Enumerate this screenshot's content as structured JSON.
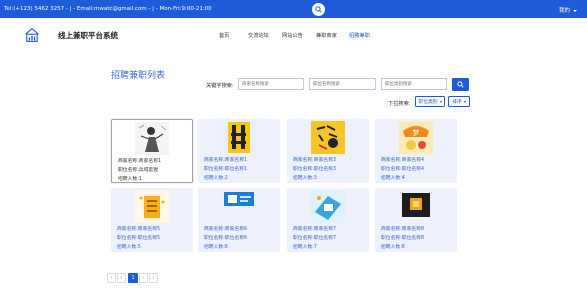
{
  "topbar": {
    "info": "Tel:(+123) 5462 3257 - | - Email:mwatc@gmail.com - | - Mon-Fri:9:00-21:00",
    "user_label": "我的"
  },
  "header": {
    "site_title": "线上兼职平台系统",
    "nav": [
      {
        "label": "首页",
        "active": false
      },
      {
        "label": "交流论坛",
        "active": false
      },
      {
        "label": "网站公告",
        "active": false
      },
      {
        "label": "兼职商家",
        "active": false
      },
      {
        "label": "招聘兼职",
        "active": true
      }
    ]
  },
  "main": {
    "title": "招聘兼职列表",
    "search": {
      "label": "关键字搜索:",
      "fields": [
        {
          "placeholder": "商家名称搜索"
        },
        {
          "placeholder": "职位名称搜索"
        },
        {
          "placeholder": "职位类别搜索"
        }
      ]
    },
    "sort": {
      "label": "下拉搜索:",
      "options": [
        "职位类别",
        "排序"
      ]
    },
    "cards": [
      {
        "merchant": "商家名称:商家名称1",
        "position": "职位名称:兵域逛猩",
        "count": "招聘人数:1",
        "selected": true
      },
      {
        "merchant": "商家名称:商家名称1",
        "position": "职位名称:职位名称1",
        "count": "招聘人数:2",
        "selected": false
      },
      {
        "merchant": "商家名称:商家名称3",
        "position": "职位名称:职位名称3",
        "count": "招聘人数:3",
        "selected": false
      },
      {
        "merchant": "商家名称:商家名称4",
        "position": "职位名称:职位名称4",
        "count": "招聘人数:4",
        "selected": false
      },
      {
        "merchant": "商家名称:商家名称5",
        "position": "职位名称:职位名称5",
        "count": "招聘人数:5",
        "selected": false
      },
      {
        "merchant": "商家名称:商家名称6",
        "position": "职位名称:职位名称6",
        "count": "招聘人数:6",
        "selected": false
      },
      {
        "merchant": "商家名称:商家名称7",
        "position": "职位名称:职位名称7",
        "count": "招聘人数:7",
        "selected": false
      },
      {
        "merchant": "商家名称:商家名称8",
        "position": "职位名称:职位名称8",
        "count": "招聘人数:8",
        "selected": false
      }
    ],
    "pagination": {
      "prev": "‹",
      "prev_more": "‹",
      "current": "1",
      "next": "›",
      "next_more": "›"
    }
  },
  "colors": {
    "primary": "#1d5bd8",
    "card_bg": "#eef1fb",
    "title": "#3a6fe0"
  }
}
